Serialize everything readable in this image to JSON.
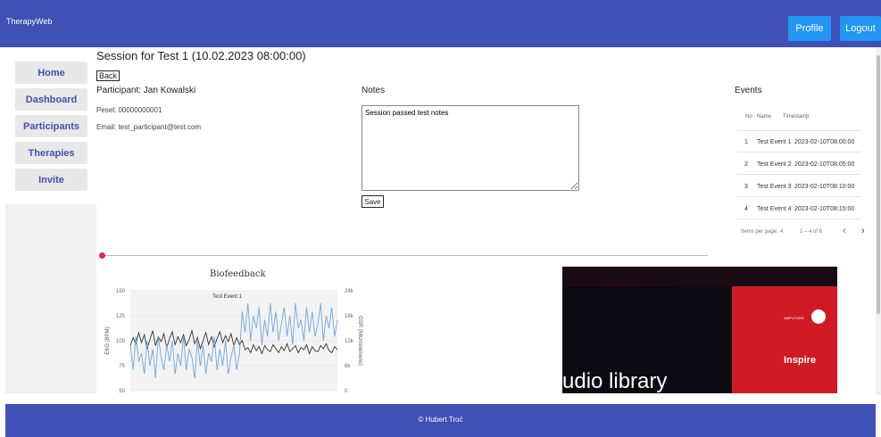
{
  "header": {
    "brand": "TherapyWeb",
    "profile_label": "Profile",
    "logout_label": "Logout"
  },
  "sidebar": {
    "items": [
      {
        "label": "Home"
      },
      {
        "label": "Dashboard"
      },
      {
        "label": "Participants"
      },
      {
        "label": "Therapies"
      },
      {
        "label": "Invite"
      }
    ]
  },
  "session": {
    "title": "Session for Test 1 (10.02.2023 08:00:00)",
    "back_label": "Back",
    "participant_heading": "Participant: Jan Kowalski",
    "pesel": "Pesel: 00000000001",
    "email": "Email: test_participant@test.com"
  },
  "notes": {
    "heading": "Notes",
    "value": "Session passed test notes",
    "save_label": "Save"
  },
  "events": {
    "heading": "Events",
    "columns": [
      "No",
      "Name",
      "Timestamp"
    ],
    "rows": [
      {
        "no": "1",
        "name": "Test Event 1",
        "timestamp": "2023-02-10T08:00:00"
      },
      {
        "no": "2",
        "name": "Test Event 2",
        "timestamp": "2023-02-10T08:05:00"
      },
      {
        "no": "3",
        "name": "Test Event 3",
        "timestamp": "2023-02-10T08:10:00"
      },
      {
        "no": "4",
        "name": "Test Event 4",
        "timestamp": "2023-02-10T08:15:00"
      }
    ],
    "items_per_page_label": "Items per page:",
    "items_per_page": "4",
    "range": "1 – 4 of 6"
  },
  "timeline": {
    "position": 0
  },
  "chart_data": {
    "type": "line",
    "title": "Biofeedback",
    "annotation": "Test Event 1",
    "ylabel": "EKG (BPM)",
    "y2label": "GSR (Microsiemens)",
    "ylim": [
      50,
      150
    ],
    "y2lim": [
      0,
      24000
    ],
    "yticks": [
      "150",
      "125",
      "100",
      "75",
      "50"
    ],
    "y2ticks": [
      "24k",
      "18k",
      "12k",
      "6k",
      "0"
    ],
    "grid": true,
    "series": [
      {
        "axis": "left",
        "color": "#333333",
        "values": [
          95,
          103,
          97,
          108,
          98,
          106,
          92,
          101,
          110,
          95,
          104,
          99,
          107,
          93,
          102,
          109,
          96,
          104,
          98,
          106,
          95,
          101,
          110,
          97,
          103,
          92,
          100,
          108,
          96,
          104,
          94,
          102,
          109,
          98,
          105,
          99,
          107,
          95,
          103,
          96,
          100,
          91,
          93,
          88,
          96,
          90,
          94,
          87,
          95,
          91,
          89,
          96,
          92,
          88,
          94,
          90,
          97,
          89,
          92,
          95,
          88,
          93,
          91,
          96,
          87,
          94,
          90,
          89,
          95,
          92,
          97,
          90,
          88,
          94,
          91
        ]
      },
      {
        "axis": "right",
        "color": "#6fa8dc",
        "values": [
          11000,
          5000,
          13000,
          7000,
          9000,
          4000,
          12000,
          6000,
          10000,
          3000,
          13000,
          8000,
          5000,
          11000,
          7000,
          12000,
          4000,
          9000,
          6000,
          13000,
          5000,
          10000,
          8000,
          3000,
          12000,
          6000,
          11000,
          4000,
          9000,
          7000,
          13000,
          5000,
          10000,
          6000,
          12000,
          4000,
          8000,
          11000,
          5000,
          9000,
          19000,
          14000,
          21000,
          12000,
          18000,
          15000,
          20000,
          11000,
          17000,
          13000,
          21000,
          14000,
          19000,
          12000,
          16000,
          20000,
          13000,
          18000,
          11000,
          21000,
          15000,
          17000,
          12000,
          20000,
          14000,
          19000,
          13000,
          16000,
          21000,
          12000,
          18000,
          15000,
          20000,
          13000,
          17000
        ]
      }
    ]
  },
  "video": {
    "caption": "udio library",
    "brand_text": "Inspire"
  },
  "footer": {
    "text": "© Hubert Troć"
  }
}
